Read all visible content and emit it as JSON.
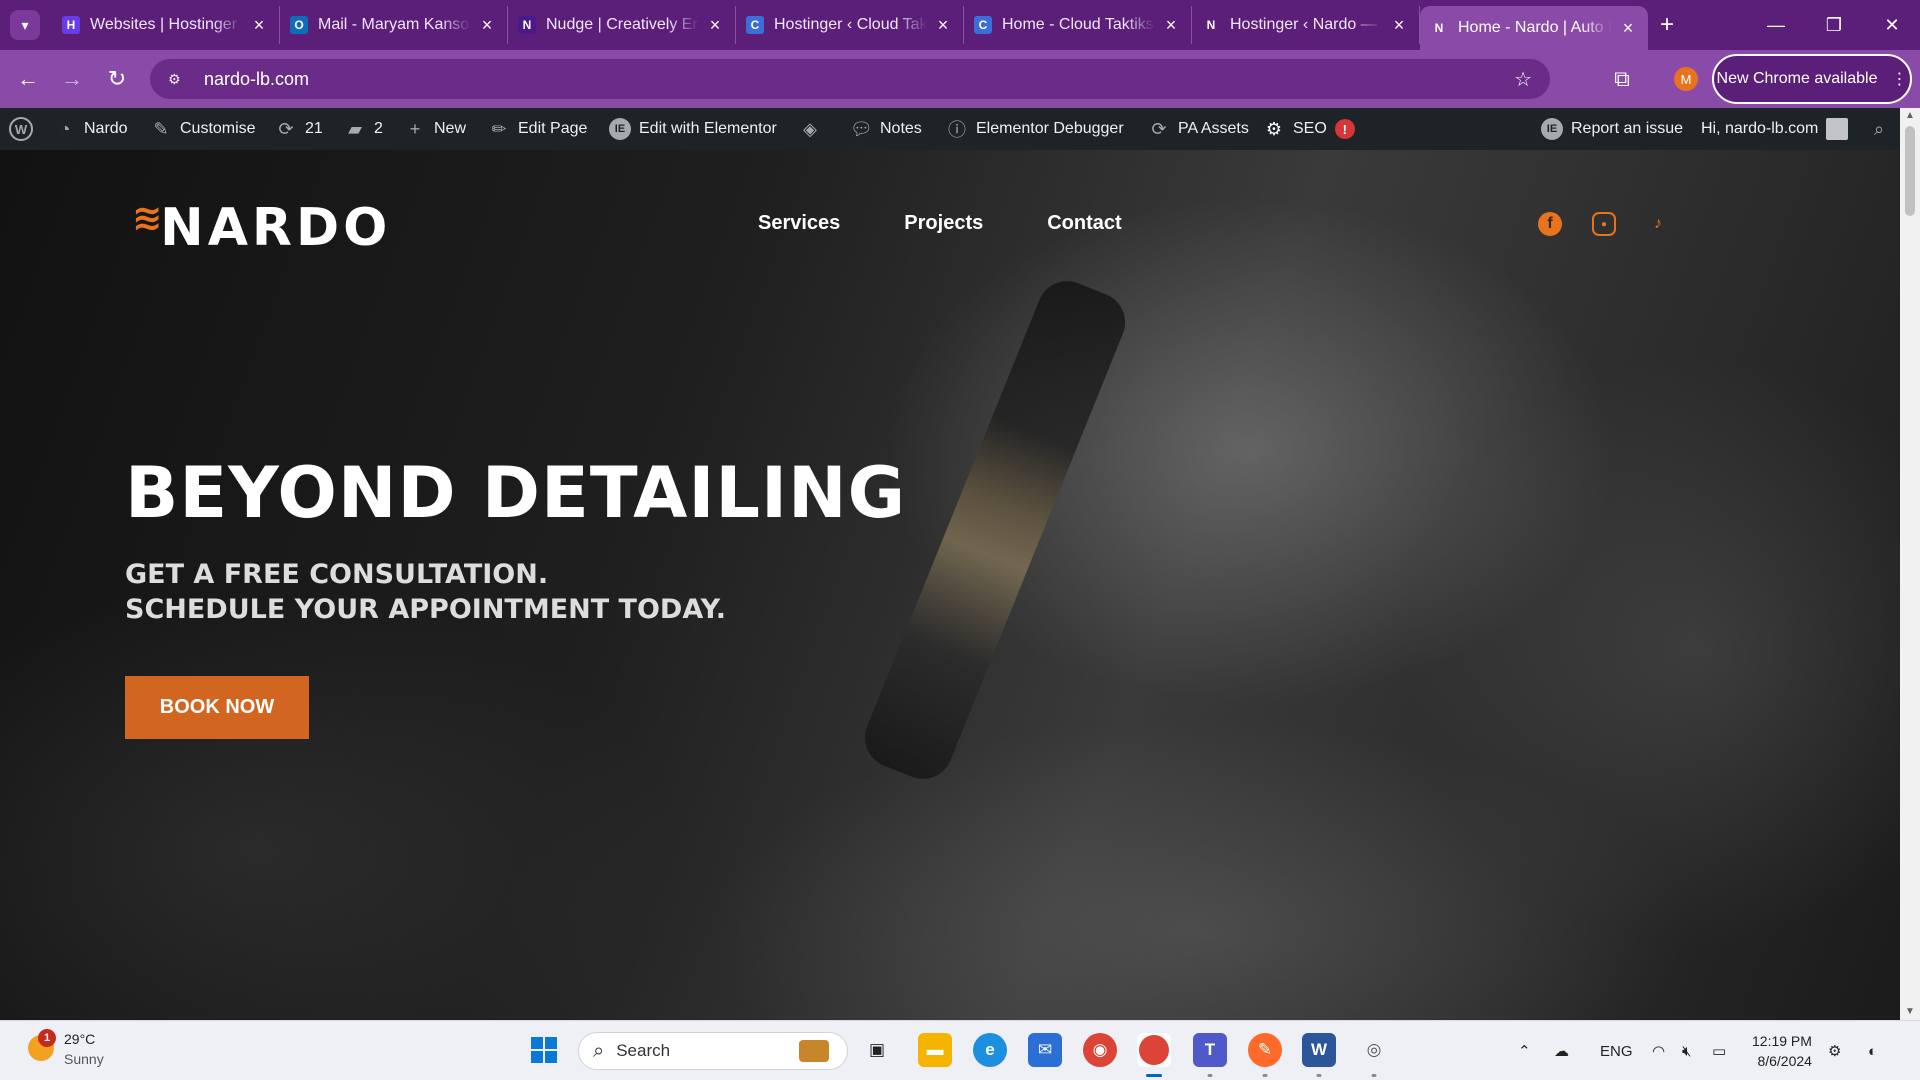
{
  "browser": {
    "tabs": [
      {
        "label": "Websites | Hostinger",
        "favicon": "H",
        "favicon_color": "#673de6"
      },
      {
        "label": "Mail - Maryam Kansou",
        "favicon": "O",
        "favicon_color": "#0f6cbd"
      },
      {
        "label": "Nudge | Creatively Engaging",
        "favicon": "N",
        "favicon_color": "#4b1a8a"
      },
      {
        "label": "Hostinger ‹ Cloud Taktiks",
        "favicon": "C",
        "favicon_color": "#3a6ed8"
      },
      {
        "label": "Home - Cloud Taktiks",
        "favicon": "C",
        "favicon_color": "#3a6ed8"
      },
      {
        "label": "Hostinger ‹ Nardo — WordPress",
        "favicon": "N",
        "favicon_color": "#ffffff"
      },
      {
        "label": "Home - Nardo | Auto Detailing",
        "favicon": "N",
        "favicon_color": "#ffffff",
        "active": true
      }
    ],
    "address": "nardo-lb.com",
    "update_button": "New Chrome available",
    "profile_initial": "M"
  },
  "wp_admin_bar": {
    "site_name": "Nardo",
    "customise": "Customise",
    "updates_count": "21",
    "comments_count": "2",
    "new": "New",
    "edit_page": "Edit Page",
    "edit_elementor": "Edit with Elementor",
    "notes": "Notes",
    "debugger": "Elementor Debugger",
    "pa_assets": "PA Assets",
    "seo": "SEO",
    "seo_alert": "!",
    "report_issue": "Report an issue",
    "greeting": "Hi, nardo-lb.com"
  },
  "site": {
    "logo": "NARDO",
    "nav": [
      "Services",
      "Projects",
      "Contact"
    ],
    "socials": [
      "facebook-icon",
      "instagram-icon",
      "tiktok-icon"
    ],
    "accent_color": "#d2651f",
    "hero_title": "BEYOND DETAILING",
    "hero_sub_line1": "GET A FREE CONSULTATION.",
    "hero_sub_line2": "SCHEDULE YOUR APPOINTMENT TODAY.",
    "cta": "BOOK NOW"
  },
  "taskbar": {
    "weather_temp": "29°C",
    "weather_desc": "Sunny",
    "weather_badge": "1",
    "search_placeholder": "Search",
    "language": "ENG",
    "time": "12:19 PM",
    "date": "8/6/2024"
  }
}
